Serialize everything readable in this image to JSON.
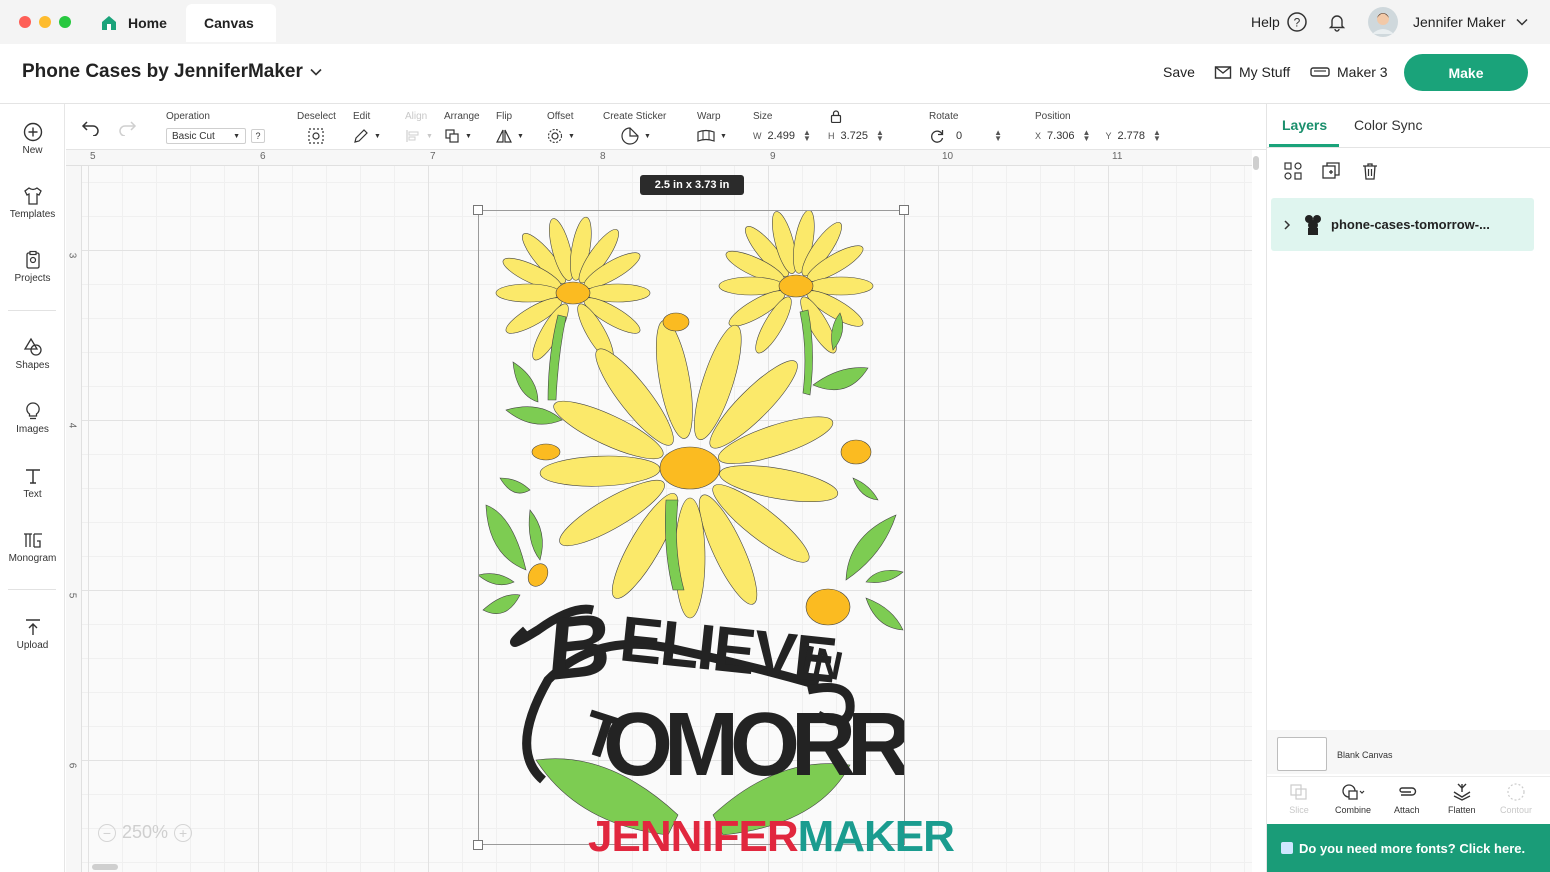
{
  "window": {
    "tabs": [
      {
        "label": "Home"
      },
      {
        "label": "Canvas"
      }
    ],
    "help_label": "Help",
    "user_name": "Jennifer Maker"
  },
  "project": {
    "title": "Phone Cases by JenniferMaker",
    "save_label": "Save",
    "my_stuff_label": "My Stuff",
    "machine_label": "Maker 3",
    "make_label": "Make"
  },
  "sidebar": {
    "items": [
      {
        "label": "New",
        "icon": "plus-circle-icon"
      },
      {
        "label": "Templates",
        "icon": "shirt-icon"
      },
      {
        "label": "Projects",
        "icon": "clipboard-icon"
      },
      {
        "label": "Shapes",
        "icon": "shapes-icon"
      },
      {
        "label": "Images",
        "icon": "lightbulb-icon"
      },
      {
        "label": "Text",
        "icon": "text-icon"
      },
      {
        "label": "Monogram",
        "icon": "monogram-icon"
      },
      {
        "label": "Upload",
        "icon": "upload-icon"
      }
    ]
  },
  "toolbar": {
    "operation_label": "Operation",
    "operation_value": "Basic Cut",
    "help_mark": "?",
    "deselect_label": "Deselect",
    "edit_label": "Edit",
    "align_label": "Align",
    "arrange_label": "Arrange",
    "flip_label": "Flip",
    "offset_label": "Offset",
    "create_sticker_label": "Create Sticker",
    "warp_label": "Warp",
    "size_label": "Size",
    "width_label": "W",
    "width_value": "2.499",
    "height_label": "H",
    "height_value": "3.725",
    "rotate_label": "Rotate",
    "rotate_value": "0",
    "position_label": "Position",
    "x_label": "X",
    "x_value": "7.306",
    "y_label": "Y",
    "y_value": "2.778"
  },
  "canvas": {
    "ruler_top": [
      "5",
      "6",
      "7",
      "8",
      "9",
      "10",
      "11"
    ],
    "ruler_left": [
      "3",
      "4",
      "5",
      "6"
    ],
    "size_tooltip": "2.5  in x 3.73  in",
    "zoom_label": "250%",
    "watermark_part1": "JENNIFER",
    "watermark_part2": "MAKER",
    "colors": {
      "accent": "#1aa37a",
      "petal": "#fbe96a",
      "petal_center": "#fbbb21",
      "leaf": "#7dcc52",
      "ink": "#222222"
    }
  },
  "panel": {
    "tab_layers": "Layers",
    "tab_color_sync": "Color Sync",
    "layer_name": "phone-cases-tomorrow-...",
    "blank_canvas_label": "Blank Canvas",
    "tools": [
      {
        "label": "Slice",
        "enabled": false
      },
      {
        "label": "Combine",
        "enabled": true
      },
      {
        "label": "Attach",
        "enabled": true
      },
      {
        "label": "Flatten",
        "enabled": true
      },
      {
        "label": "Contour",
        "enabled": false
      }
    ],
    "fonts_banner": "Do you need more fonts? Click here."
  }
}
